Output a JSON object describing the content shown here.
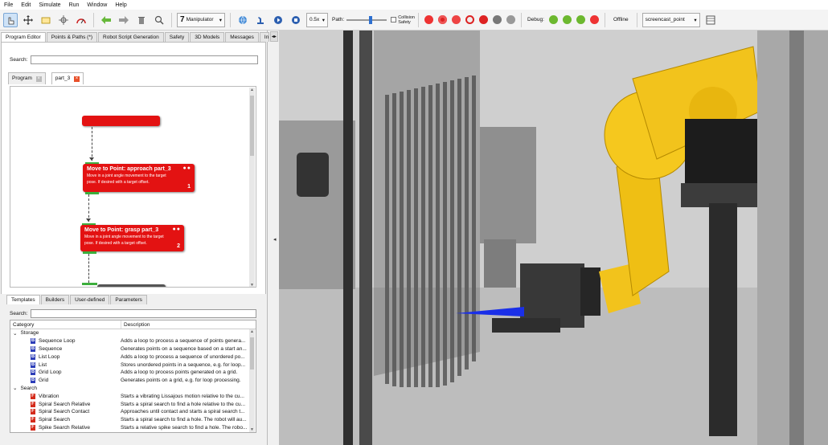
{
  "menu": [
    "File",
    "Edit",
    "Simulate",
    "Run",
    "Window",
    "Help"
  ],
  "toolbar": {
    "manipulator_label": "Manipulator",
    "speed_value": "0.5x",
    "path_label": "Path:",
    "collision_label_1": "Collision",
    "collision_label_2": "Safety",
    "debug_label": "Debug:",
    "offline_label": "Offline",
    "point_select": "screencast_point"
  },
  "main_tabs": [
    "Program Editor",
    "Points & Paths (*)",
    "Robot Script Generation",
    "Safety",
    "3D Models",
    "Messages",
    "Info"
  ],
  "search_label": "Search:",
  "program_tabs": [
    "Program",
    "part_3"
  ],
  "nodes": [
    {
      "title": "Move to Point: approach part_3",
      "desc_1": "Move in a joint angle movement to the target",
      "desc_2": "pose. If desired with a target offset.",
      "num": "1"
    },
    {
      "title": "Move to Point: grasp part_3",
      "desc_1": "Move in a joint angle movement to the target",
      "desc_2": "pose. If desired with a target offset.",
      "num": "2"
    }
  ],
  "template_tabs": [
    "Templates",
    "Builders",
    "User-defined",
    "Parameters"
  ],
  "template_search_label": "Search:",
  "columns": [
    "Category",
    "Description"
  ],
  "groups": [
    {
      "name": "Storage",
      "items": [
        {
          "name": "Sequence Loop",
          "desc": "Adds a loop to process a sequence of points genera..."
        },
        {
          "name": "Sequence",
          "desc": "Generates points on a sequence based on a start an..."
        },
        {
          "name": "List Loop",
          "desc": "Adds a loop to process a sequence of unordered po..."
        },
        {
          "name": "List",
          "desc": "Stores unordered points in a sequence, e.g. for loop..."
        },
        {
          "name": "Grid Loop",
          "desc": "Adds a loop to process points generated on a grid."
        },
        {
          "name": "Grid",
          "desc": "Generates points on a grid, e.g. for loop processing."
        }
      ]
    },
    {
      "name": "Search",
      "items": [
        {
          "name": "Vibration",
          "desc": "Starts a vibrating Lissajous motion relative to the cu..."
        },
        {
          "name": "Spiral Search Relative",
          "desc": "Starts a spiral search to find a hole relative to the cu..."
        },
        {
          "name": "Spiral Search Contact",
          "desc": "Approaches until contact and starts a spiral search t..."
        },
        {
          "name": "Spiral Search",
          "desc": "Starts a spiral search to find a hole. The robot will au..."
        },
        {
          "name": "Spike Search Relative",
          "desc": "Starts a relative spike search to find a hole. The robo..."
        }
      ]
    }
  ],
  "colors": {
    "node_red": "#e31212",
    "robot_yellow": "#f2c31c",
    "accent_green": "#3cae3c"
  }
}
